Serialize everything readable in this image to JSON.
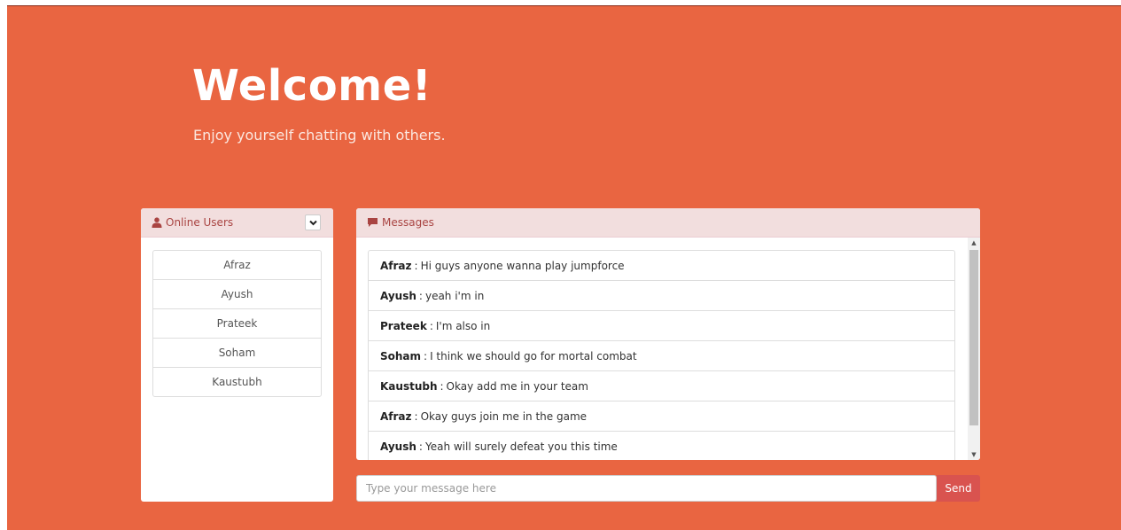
{
  "hero": {
    "title": "Welcome!",
    "subtitle": "Enjoy yourself chatting with others."
  },
  "users_panel": {
    "title": "Online Users",
    "header_icon": "user-icon",
    "toggle_icon": "chevron-down-icon",
    "users": [
      "Afraz",
      "Ayush",
      "Prateek",
      "Soham",
      "Kaustubh"
    ]
  },
  "messages_panel": {
    "title": "Messages",
    "header_icon": "comment-icon",
    "messages": [
      {
        "author": "Afraz",
        "text": "Hi guys anyone wanna play jumpforce"
      },
      {
        "author": "Ayush",
        "text": "yeah i'm in"
      },
      {
        "author": "Prateek",
        "text": "I'm also in"
      },
      {
        "author": "Soham",
        "text": "I think we should go for mortal combat"
      },
      {
        "author": "Kaustubh",
        "text": "Okay add me in your team"
      },
      {
        "author": "Afraz",
        "text": "Okay guys join me in the game"
      },
      {
        "author": "Ayush",
        "text": "Yeah will surely defeat you this time"
      }
    ],
    "separator": ":"
  },
  "composer": {
    "placeholder": "Type your message here",
    "value": "",
    "send_label": "Send"
  },
  "colors": {
    "background": "#e96541",
    "panel_header": "#f2dede",
    "panel_header_text": "#a94442",
    "send_button": "#d9534f"
  }
}
